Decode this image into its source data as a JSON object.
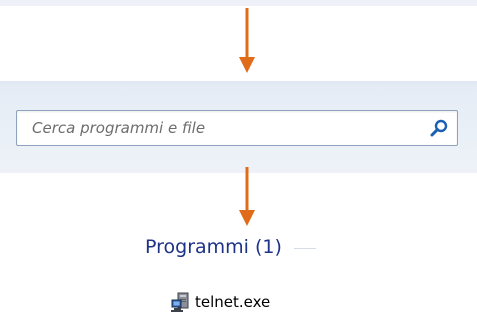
{
  "search": {
    "placeholder": "Cerca programmi e file",
    "value": ""
  },
  "results": {
    "section_title": "Programmi (1)",
    "items": [
      {
        "label": "telnet.exe",
        "icon": "terminal-program-icon"
      }
    ]
  },
  "annotations": {
    "arrow_color": "#e06c1a"
  },
  "icons": {
    "search": "search-icon",
    "program": "terminal-program-icon"
  },
  "colors": {
    "section_title": "#1e3287",
    "search_band": "#eaf0f7",
    "search_border": "#8ea3bd",
    "search_icon": "#1a5fb4"
  }
}
